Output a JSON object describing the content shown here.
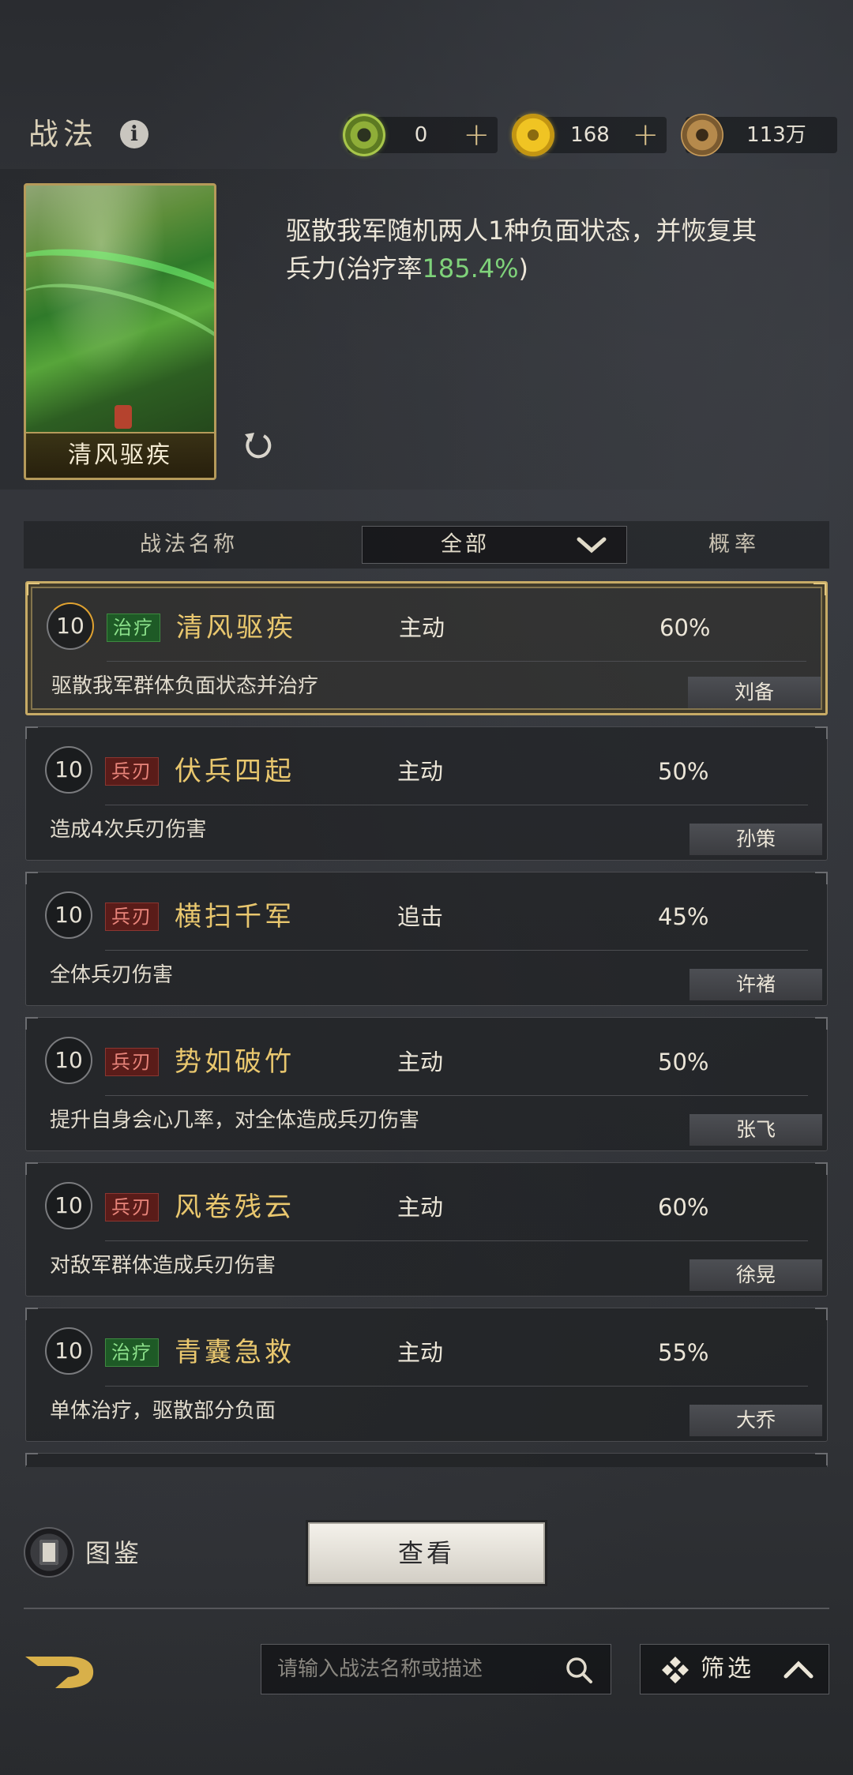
{
  "header": {
    "title": "战法",
    "currencies": [
      {
        "name": "jade",
        "icon": "jade-coin-icon",
        "amount": "0",
        "has_plus": true
      },
      {
        "name": "gold",
        "icon": "gold-coin-icon",
        "amount": "168",
        "has_plus": true
      },
      {
        "name": "copper",
        "icon": "copper-coin-icon",
        "amount": "113万",
        "has_plus": false
      }
    ],
    "plus_label": "+"
  },
  "detail": {
    "card_name": "清风驱疾",
    "desc_main": "驱散我军随机两人1种负面状态，并恢复其兵力(治疗率",
    "desc_highlight": "185.4%",
    "desc_tail": ")"
  },
  "table_header": {
    "name_col": "战法名称",
    "filter": "全部",
    "rate_col": "概率"
  },
  "skills": [
    {
      "level": "10",
      "tag": "治疗",
      "tag_type": "heal",
      "name": "清风驱疾",
      "type": "主动",
      "rate": "60%",
      "desc": "驱散我军群体负面状态并治疗",
      "owner": "刘备",
      "selected": true
    },
    {
      "level": "10",
      "tag": "兵刃",
      "tag_type": "blade",
      "name": "伏兵四起",
      "type": "主动",
      "rate": "50%",
      "desc": "造成4次兵刃伤害",
      "owner": "孙策",
      "selected": false
    },
    {
      "level": "10",
      "tag": "兵刃",
      "tag_type": "blade",
      "name": "横扫千军",
      "type": "追击",
      "rate": "45%",
      "desc": "全体兵刃伤害",
      "owner": "许褚",
      "selected": false
    },
    {
      "level": "10",
      "tag": "兵刃",
      "tag_type": "blade",
      "name": "势如破竹",
      "type": "主动",
      "rate": "50%",
      "desc": "提升自身会心几率，对全体造成兵刃伤害",
      "owner": "张飞",
      "selected": false
    },
    {
      "level": "10",
      "tag": "兵刃",
      "tag_type": "blade",
      "name": "风卷残云",
      "type": "主动",
      "rate": "60%",
      "desc": "对敌军群体造成兵刃伤害",
      "owner": "徐晃",
      "selected": false
    },
    {
      "level": "10",
      "tag": "治疗",
      "tag_type": "heal",
      "name": "青囊急救",
      "type": "主动",
      "rate": "55%",
      "desc": "单体治疗，驱散部分负面",
      "owner": "大乔",
      "selected": false
    }
  ],
  "bottom": {
    "codex_label": "图鉴",
    "view_button": "查看",
    "search_placeholder": "请输入战法名称或描述",
    "filter_label": "筛选"
  },
  "colors": {
    "gold_text": "#e9c76e",
    "heal_tag": "#1e5a26",
    "blade_tag": "#5a1c19",
    "highlight_green": "#7fd27a",
    "selected_border": "#c7ab66"
  }
}
